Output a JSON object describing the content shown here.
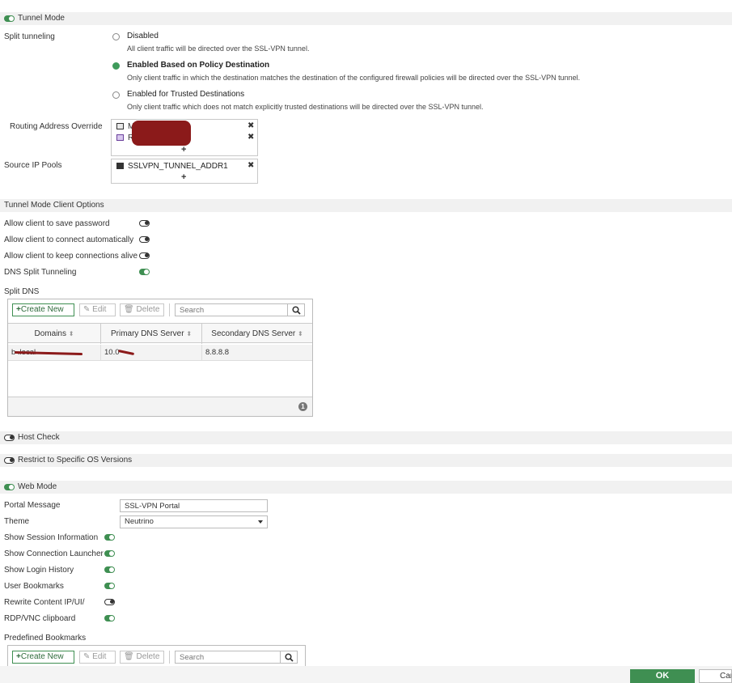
{
  "tunnel_mode": {
    "label": "Tunnel Mode",
    "split_tunneling_label": "Split tunneling",
    "options": [
      {
        "title": "Disabled",
        "desc": "All client traffic will be directed over the SSL-VPN tunnel."
      },
      {
        "title": "Enabled Based on Policy Destination",
        "desc": "Only client traffic in which the destination matches the destination of the configured firewall policies will be directed over the SSL-VPN tunnel."
      },
      {
        "title": "Enabled for Trusted Destinations",
        "desc": "Only client traffic which does not match explicitly trusted destinations will be directed over the SSL-VPN tunnel."
      }
    ],
    "routing_override_label": "Routing Address Override",
    "routing_items": [
      "M",
      "R"
    ],
    "source_ip_label": "Source IP Pools",
    "source_ip_items": [
      "SSLVPN_TUNNEL_ADDR1"
    ],
    "add_symbol": "+",
    "remove_symbol": "✖"
  },
  "client_options": {
    "label": "Tunnel Mode Client Options",
    "items": [
      {
        "label": "Allow client to save password",
        "enabled": false
      },
      {
        "label": "Allow client to connect automatically",
        "enabled": false
      },
      {
        "label": "Allow client to keep connections alive",
        "enabled": false
      },
      {
        "label": "DNS Split Tunneling",
        "enabled": true
      }
    ]
  },
  "split_dns": {
    "label": "Split DNS",
    "toolbar": {
      "create": "Create New",
      "edit": "Edit",
      "delete": "Delete",
      "search_placeholder": "Search"
    },
    "columns": [
      "Domains",
      "Primary DNS Server",
      "Secondary DNS Server"
    ],
    "rows": [
      {
        "domain": "b                    .local",
        "primary": "10.0",
        "secondary": "8.8.8.8"
      }
    ],
    "count": "1"
  },
  "host_check": {
    "label": "Host Check"
  },
  "restrict_os": {
    "label": "Restrict to Specific OS Versions"
  },
  "web_mode": {
    "label": "Web Mode",
    "portal_message_label": "Portal Message",
    "portal_message_value": "SSL-VPN Portal",
    "theme_label": "Theme",
    "theme_value": "Neutrino",
    "toggles": [
      {
        "label": "Show Session Information",
        "enabled": true
      },
      {
        "label": "Show Connection Launcher",
        "enabled": true
      },
      {
        "label": "Show Login History",
        "enabled": true
      },
      {
        "label": "User Bookmarks",
        "enabled": true
      },
      {
        "label": "Rewrite Content IP/UI/",
        "enabled": false
      },
      {
        "label": "RDP/VNC clipboard",
        "enabled": true
      }
    ],
    "predefined_label": "Predefined Bookmarks",
    "toolbar": {
      "create": "Create New",
      "edit": "Edit",
      "delete": "Delete",
      "search_placeholder": "Search"
    }
  },
  "footer": {
    "ok": "OK",
    "cancel": "Car"
  },
  "colors": {
    "accent": "#3f8f52",
    "ok_button": "#3f8f52",
    "redaction": "#8b1a1a"
  }
}
